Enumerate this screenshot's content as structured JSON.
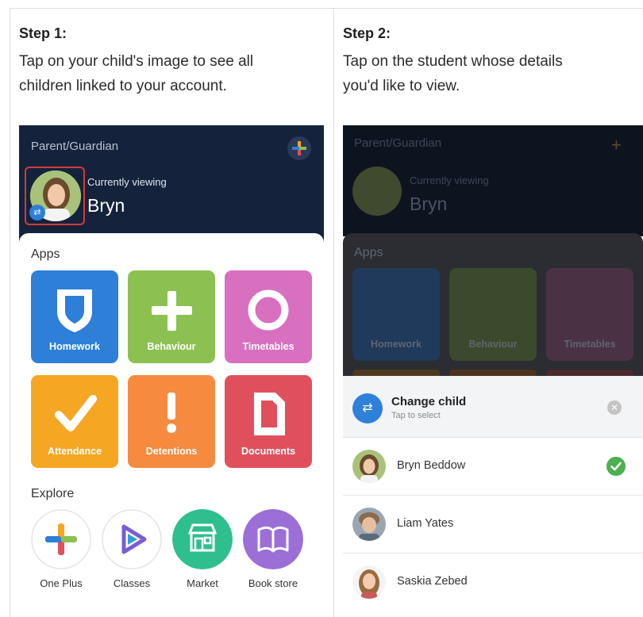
{
  "steps": [
    {
      "title": "Step 1:",
      "text_line1": "Tap on your child's image to see all",
      "text_line2": "children linked to your account."
    },
    {
      "title": "Step 2:",
      "text_line1": "Tap on the student whose details",
      "text_line2": "you'd like to view."
    }
  ],
  "phone1": {
    "header_label": "Parent/Guardian",
    "currently_viewing_label": "Currently viewing",
    "child_name": "Bryn",
    "apps_label": "Apps",
    "apps": [
      {
        "label": "Homework",
        "color": "#2d7fd8"
      },
      {
        "label": "Behaviour",
        "color": "#8cc152"
      },
      {
        "label": "Timetables",
        "color": "#d86fbf"
      },
      {
        "label": "Attendance",
        "color": "#f5a623"
      },
      {
        "label": "Detentions",
        "color": "#f68a3e"
      },
      {
        "label": "Documents",
        "color": "#e0505c"
      }
    ],
    "explore_label": "Explore",
    "explore": [
      {
        "label": "One Plus",
        "icon": "plus-icon"
      },
      {
        "label": "Classes",
        "icon": "play-icon"
      },
      {
        "label": "Market",
        "icon": "store-icon"
      },
      {
        "label": "Book store",
        "icon": "book-icon"
      }
    ]
  },
  "phone2": {
    "header_label": "Parent/Guardian",
    "currently_viewing_label": "Currently viewing",
    "child_name": "Bryn",
    "apps_label": "Apps",
    "apps": [
      "Homework",
      "Behaviour",
      "Timetables"
    ],
    "sheet": {
      "title": "Change child",
      "subtitle": "Tap to select",
      "children": [
        {
          "name": "Bryn Beddow",
          "selected": true
        },
        {
          "name": "Liam Yates",
          "selected": false
        },
        {
          "name": "Saskia Zebed",
          "selected": false
        }
      ]
    }
  },
  "colors": {
    "header_dark": "#15223b",
    "switch_blue": "#2f80d9",
    "check_green": "#4caf50",
    "highlight_red": "#d63a3a"
  }
}
